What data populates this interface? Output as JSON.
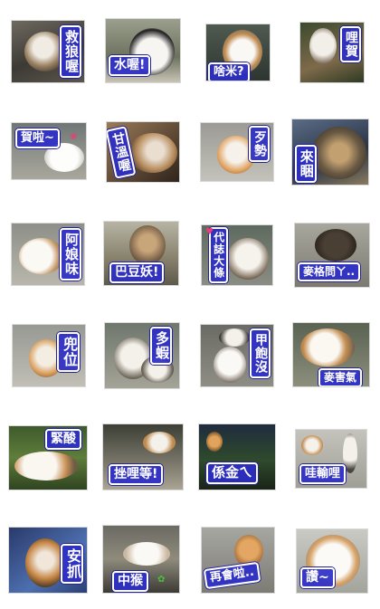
{
  "stickers": [
    {
      "caption": "救狼喔",
      "row": 1,
      "col": 1
    },
    {
      "caption": "水喔!",
      "row": 1,
      "col": 2
    },
    {
      "caption": "啥米?",
      "row": 1,
      "col": 3
    },
    {
      "caption": "哩賀",
      "row": 1,
      "col": 4
    },
    {
      "caption": "賀啦~",
      "row": 2,
      "col": 1
    },
    {
      "caption": "甘溫喔",
      "row": 2,
      "col": 2
    },
    {
      "caption": "歹勢",
      "row": 2,
      "col": 3
    },
    {
      "caption": "來睏",
      "row": 2,
      "col": 4
    },
    {
      "caption": "阿娘味",
      "row": 3,
      "col": 1
    },
    {
      "caption": "巴豆妖!",
      "row": 3,
      "col": 2
    },
    {
      "caption": "代誌大條",
      "row": 3,
      "col": 3
    },
    {
      "caption": "麥格問ㄚ..",
      "row": 3,
      "col": 4
    },
    {
      "caption": "兜位",
      "row": 4,
      "col": 1
    },
    {
      "caption": "多蝦",
      "row": 4,
      "col": 2
    },
    {
      "caption": "甲飽沒",
      "row": 4,
      "col": 3
    },
    {
      "caption": "麥害氣",
      "row": 4,
      "col": 4
    },
    {
      "caption": "緊酸",
      "row": 5,
      "col": 1
    },
    {
      "caption": "挫哩等!",
      "row": 5,
      "col": 2
    },
    {
      "caption": "係金ㄟ",
      "row": 5,
      "col": 3
    },
    {
      "caption": "哇輸哩",
      "row": 5,
      "col": 4
    },
    {
      "caption": "安抓",
      "row": 6,
      "col": 1
    },
    {
      "caption": "中猴",
      "row": 6,
      "col": 2
    },
    {
      "caption": "再會啦..",
      "row": 6,
      "col": 3
    },
    {
      "caption": "讚~",
      "row": 6,
      "col": 4
    }
  ],
  "colors": {
    "caption_fill": "#2c2ec8",
    "caption_text": "#ffffff",
    "heart_accent": "#e83d7a",
    "paw_accent": "#47c13d"
  }
}
